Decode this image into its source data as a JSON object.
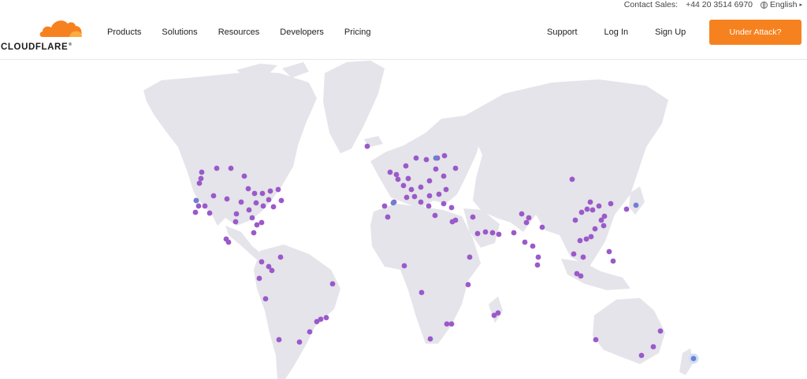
{
  "topbar": {
    "contact_label": "Contact Sales:",
    "phone": "+44 20 3514 6970",
    "language": "English"
  },
  "header": {
    "brand": "CLOUDFLARE",
    "nav_left": [
      "Products",
      "Solutions",
      "Resources",
      "Developers",
      "Pricing"
    ],
    "nav_right": [
      "Support",
      "Log In",
      "Sign Up"
    ],
    "cta_label": "Under Attack?"
  },
  "colors": {
    "accent": "#f6821f",
    "land": "#e4e4ea",
    "pop": "#9b59c9",
    "pop_highlight": "#6f7fcf"
  },
  "icons": {
    "logo": "cloud-logo-icon",
    "language": "globe-icon"
  }
}
